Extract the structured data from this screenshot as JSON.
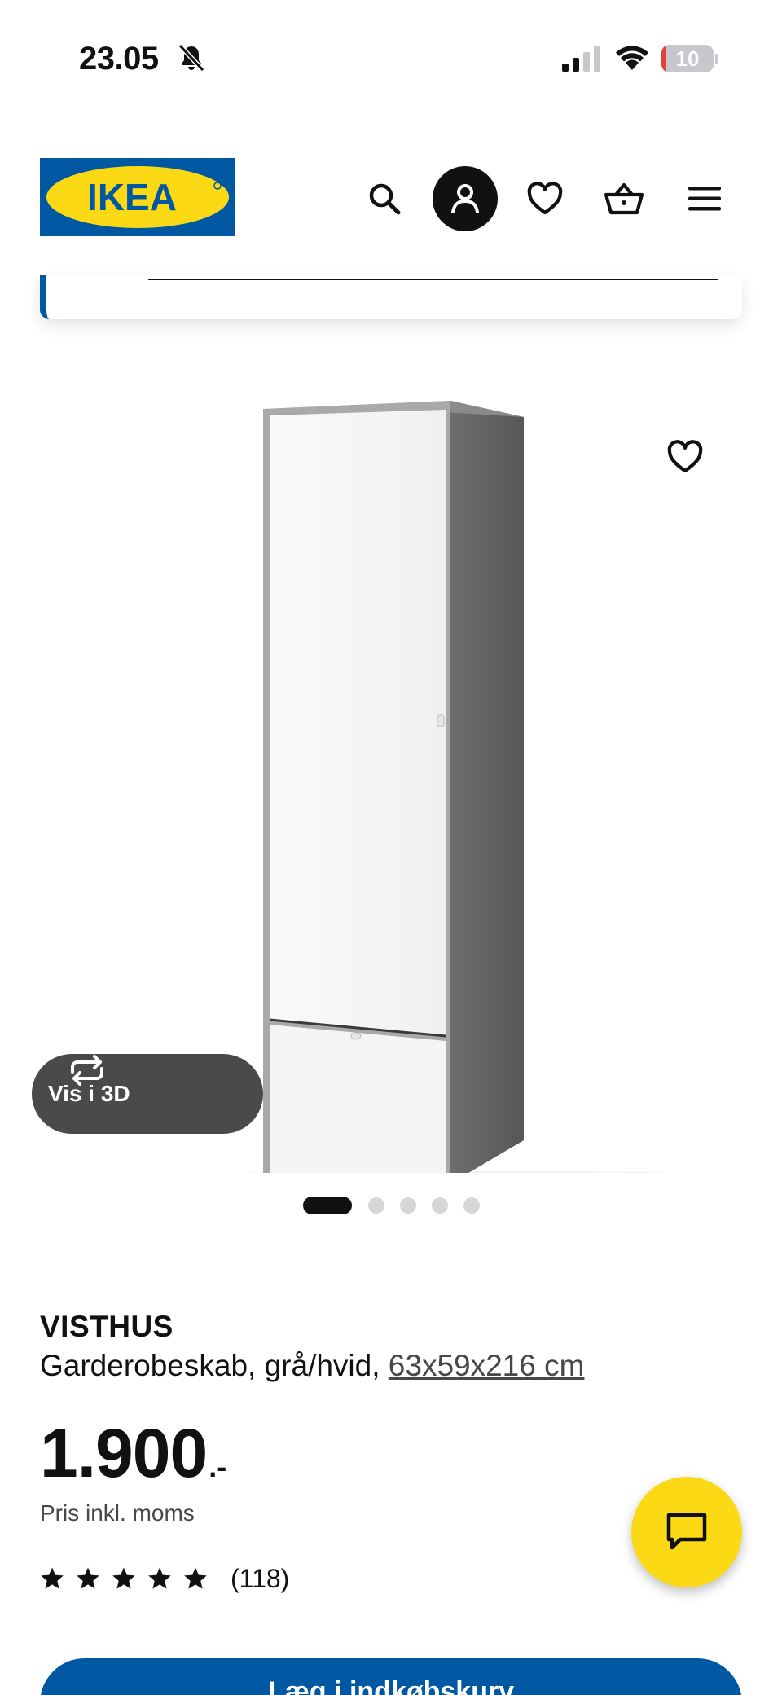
{
  "status_bar": {
    "time": "23.05",
    "battery_level": "10",
    "battery_fraction": 0.1
  },
  "header": {
    "logo_text": "IKEA",
    "icons": [
      "search-icon",
      "account-icon",
      "heart-icon",
      "cart-icon",
      "menu-icon"
    ]
  },
  "product": {
    "name": "VISTHUS",
    "description": "Garderobeskab, grå/hvid, ",
    "size": "63x59x216 cm",
    "price_integer": "1.900",
    "price_suffix": ".-",
    "price_note": "Pris inkl. moms",
    "rating_stars": 5,
    "rating_count": "(118)"
  },
  "gallery": {
    "view_3d_label": "Vis i 3D",
    "slide_count": 5,
    "active_slide": 1
  },
  "cta": {
    "label": "Læg i indkøbskurv"
  },
  "colors": {
    "ikea_blue": "#0058a3",
    "ikea_yellow": "#fbd914",
    "battery_low": "#e0413b"
  }
}
